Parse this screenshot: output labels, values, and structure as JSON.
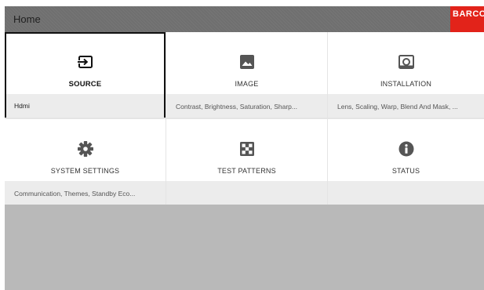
{
  "header": {
    "title": "Home",
    "logo_text": "BARCO"
  },
  "tiles": [
    {
      "label": "SOURCE",
      "icon": "source-input-icon",
      "sub": "Hdmi",
      "selected": true
    },
    {
      "label": "IMAGE",
      "icon": "image-icon",
      "sub": "Contrast, Brightness, Saturation, Sharp..."
    },
    {
      "label": "INSTALLATION",
      "icon": "projector-lens-icon",
      "sub": "Lens, Scaling, Warp, Blend And Mask, ..."
    },
    {
      "label": "SYSTEM SETTINGS",
      "icon": "gear-icon",
      "sub": "Communication, Themes, Standby Eco..."
    },
    {
      "label": "TEST PATTERNS",
      "icon": "checkerboard-icon",
      "sub": ""
    },
    {
      "label": "STATUS",
      "icon": "info-icon",
      "sub": ""
    }
  ],
  "colors": {
    "header_bg": "#6f6f6f",
    "logo_bg": "#e2231a",
    "tile_bg": "#ffffff",
    "tile_sub_bg": "#ececec",
    "background": "#b9b9b9",
    "selected_border": "#111111"
  }
}
